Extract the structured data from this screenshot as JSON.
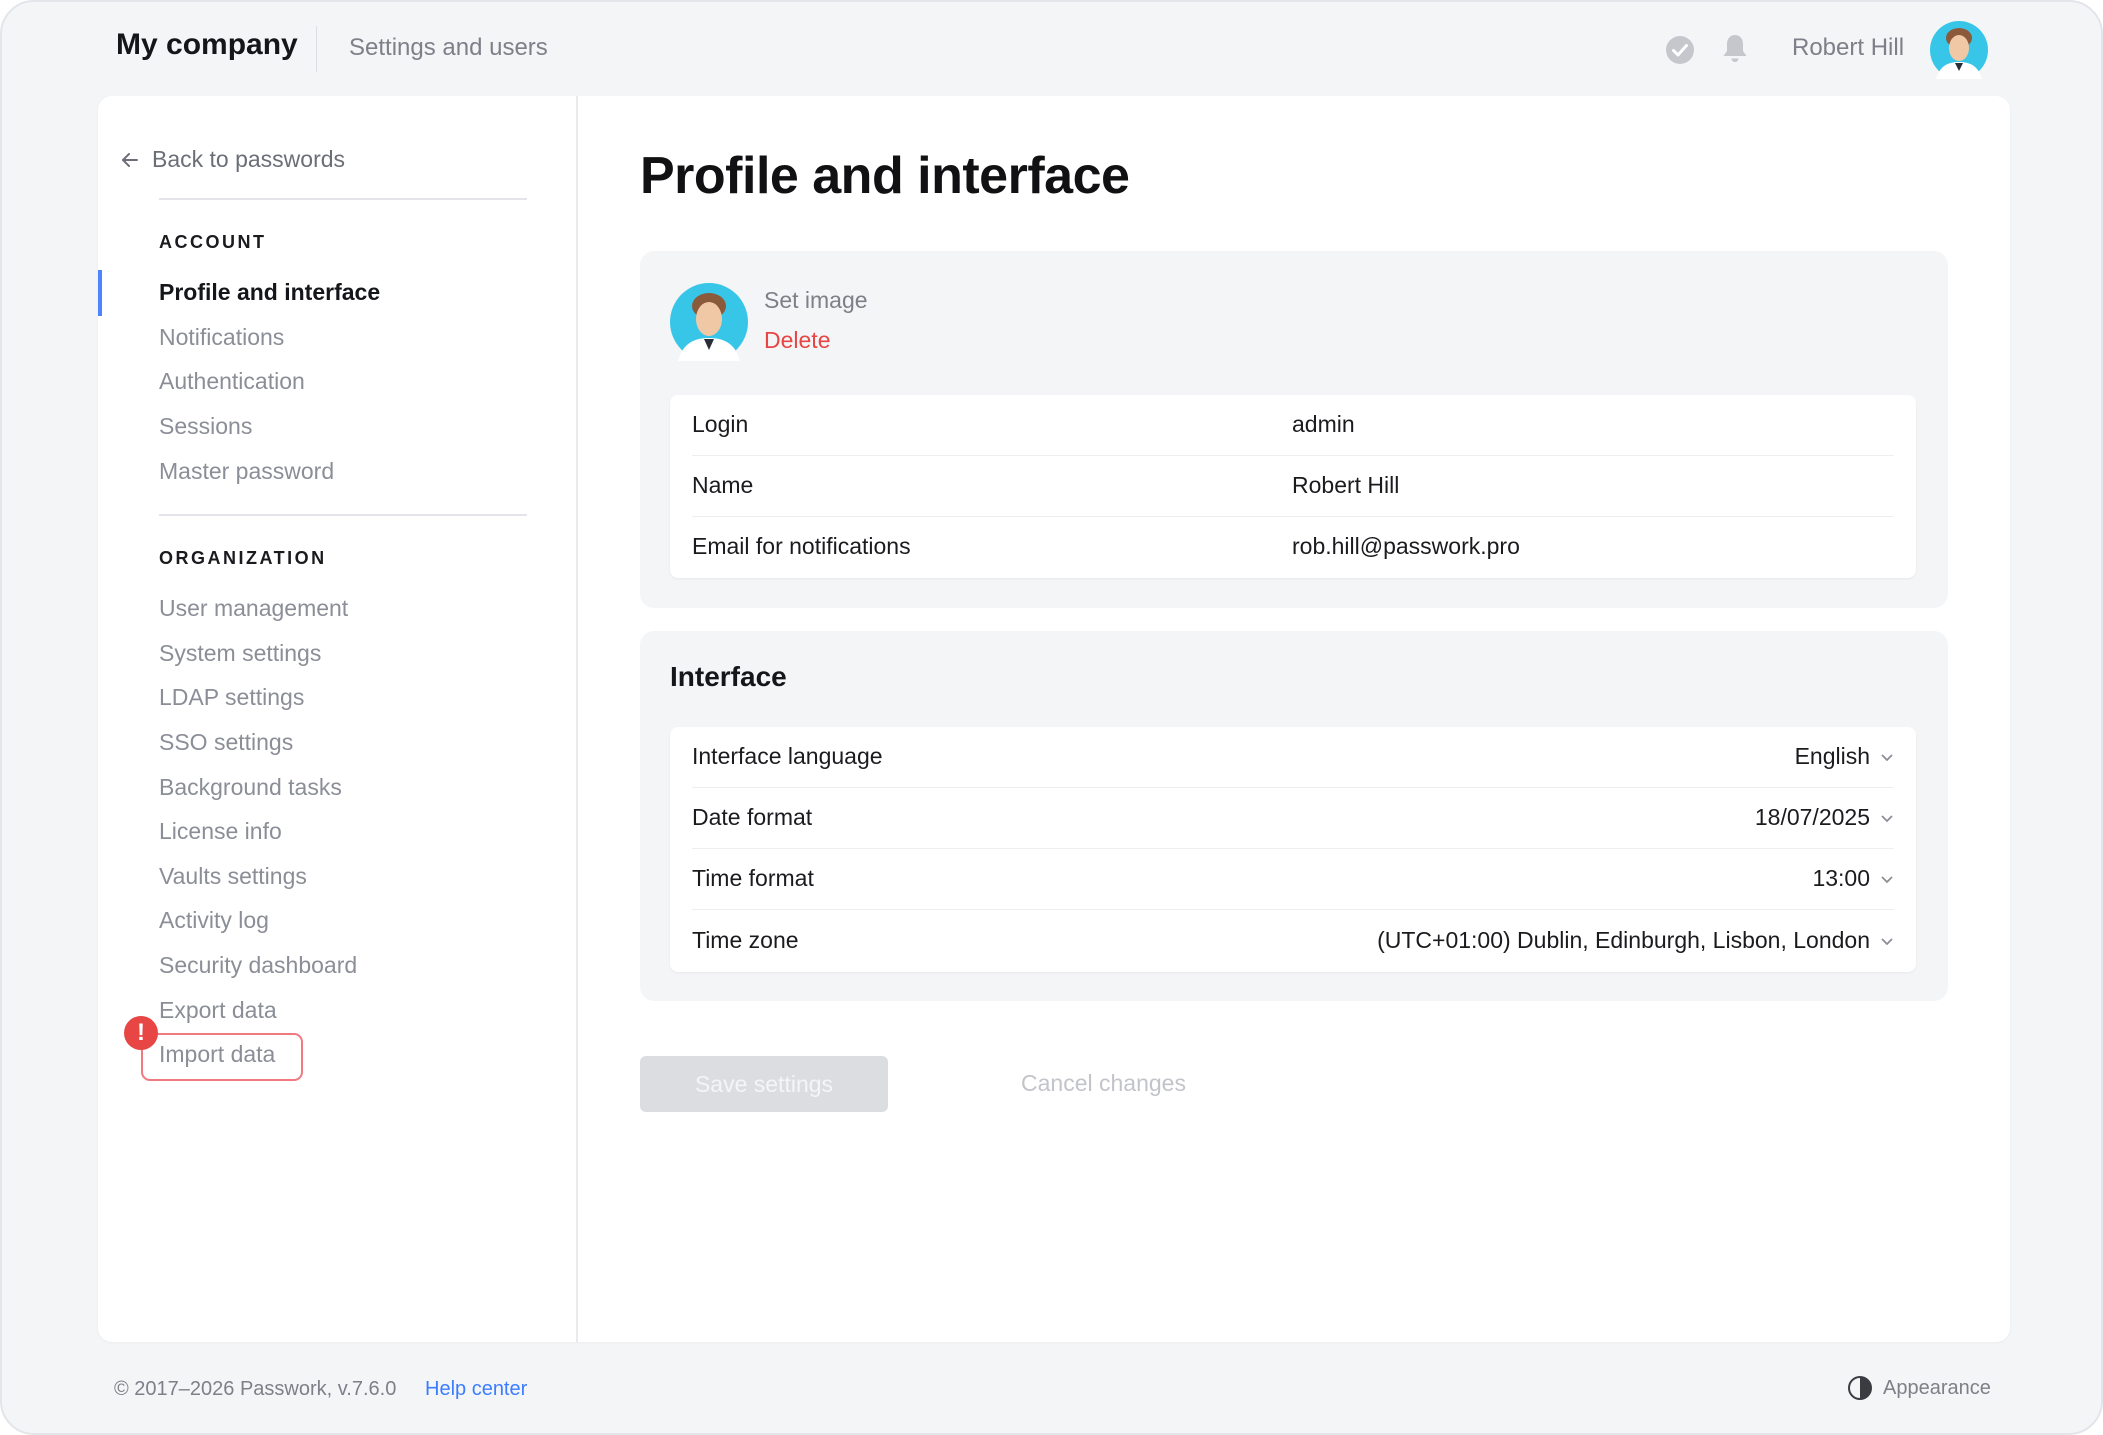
{
  "header": {
    "brand": "My company",
    "section": "Settings and users",
    "user_name": "Robert Hill",
    "icons": [
      "check-circle-icon",
      "bell-icon"
    ]
  },
  "sidebar": {
    "back_label": "Back to passwords",
    "account_heading": "ACCOUNT",
    "account_items": [
      {
        "label": "Profile and interface",
        "active": true
      },
      {
        "label": "Notifications"
      },
      {
        "label": "Authentication"
      },
      {
        "label": "Sessions"
      },
      {
        "label": "Master password"
      }
    ],
    "organization_heading": "ORGANIZATION",
    "organization_items": [
      {
        "label": "User management"
      },
      {
        "label": "System settings"
      },
      {
        "label": "LDAP settings"
      },
      {
        "label": "SSO settings"
      },
      {
        "label": "Background tasks"
      },
      {
        "label": "License info"
      },
      {
        "label": "Vaults settings"
      },
      {
        "label": "Activity log"
      },
      {
        "label": "Security dashboard"
      },
      {
        "label": "Export data"
      },
      {
        "label": "Import data",
        "highlighted": true
      }
    ],
    "alert_badge": "!"
  },
  "main": {
    "title": "Profile and interface",
    "profile": {
      "set_image": "Set image",
      "delete": "Delete",
      "fields": [
        {
          "label": "Login",
          "value": "admin"
        },
        {
          "label": "Name",
          "value": "Robert Hill"
        },
        {
          "label": "Email for notifications",
          "value": "rob.hill@passwork.pro"
        }
      ]
    },
    "interface": {
      "title": "Interface",
      "fields": [
        {
          "label": "Interface language",
          "value": "English"
        },
        {
          "label": "Date format",
          "value": "18/07/2025"
        },
        {
          "label": "Time format",
          "value": "13:00"
        },
        {
          "label": "Time zone",
          "value": "(UTC+01:00) Dublin, Edinburgh, Lisbon, London"
        }
      ]
    },
    "save_label": "Save settings",
    "cancel_label": "Cancel changes"
  },
  "footer": {
    "copyright": "© 2017–2026 Passwork, v.7.6.0",
    "help": "Help center",
    "appearance": "Appearance"
  },
  "colors": {
    "accent": "#4f84ff",
    "danger": "#e84545",
    "link": "#3c7dff",
    "avatar_bg": "#38c6e8"
  }
}
